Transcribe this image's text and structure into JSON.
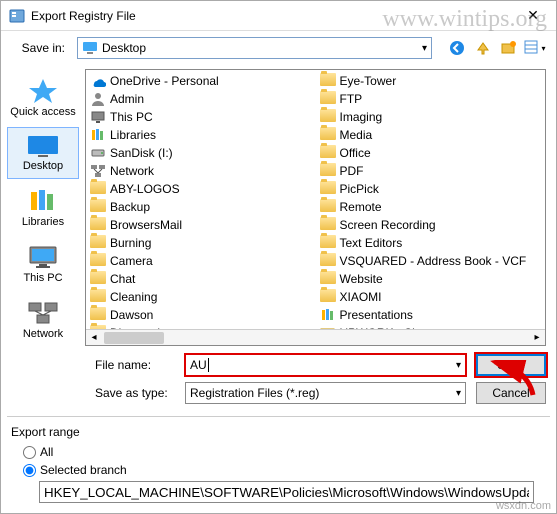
{
  "title": "Export Registry File",
  "watermark": "www.wintips.org",
  "watermark2": "wsxdn.com",
  "save_in_label": "Save in:",
  "save_in_value": "Desktop",
  "places": {
    "quick_access": "Quick access",
    "desktop": "Desktop",
    "libraries": "Libraries",
    "this_pc": "This PC",
    "network": "Network"
  },
  "col1": [
    {
      "label": "OneDrive - Personal",
      "icon": "onedrive"
    },
    {
      "label": "Admin",
      "icon": "user"
    },
    {
      "label": "This PC",
      "icon": "pc"
    },
    {
      "label": "Libraries",
      "icon": "libraries"
    },
    {
      "label": "SanDisk (I:)",
      "icon": "drive"
    },
    {
      "label": "Network",
      "icon": "network"
    },
    {
      "label": "ABY-LOGOS",
      "icon": "folder"
    },
    {
      "label": "Backup",
      "icon": "folder"
    },
    {
      "label": "BrowsersMail",
      "icon": "folder"
    },
    {
      "label": "Burning",
      "icon": "folder"
    },
    {
      "label": "Camera",
      "icon": "folder"
    },
    {
      "label": "Chat",
      "icon": "folder"
    },
    {
      "label": "Cleaning",
      "icon": "folder"
    },
    {
      "label": "Dawson",
      "icon": "folder"
    },
    {
      "label": "Diagnostics",
      "icon": "folder"
    }
  ],
  "col2": [
    {
      "label": "Eye-Tower",
      "icon": "folder"
    },
    {
      "label": "FTP",
      "icon": "folder"
    },
    {
      "label": "Imaging",
      "icon": "folder"
    },
    {
      "label": "Media",
      "icon": "folder"
    },
    {
      "label": "Office",
      "icon": "folder"
    },
    {
      "label": "PDF",
      "icon": "folder"
    },
    {
      "label": "PicPick",
      "icon": "folder"
    },
    {
      "label": "Remote",
      "icon": "folder"
    },
    {
      "label": "Screen Recording",
      "icon": "folder"
    },
    {
      "label": "Text Editors",
      "icon": "folder"
    },
    {
      "label": "VSQUARED - Address Book - VCF",
      "icon": "folder"
    },
    {
      "label": "Website",
      "icon": "folder"
    },
    {
      "label": "XIAOMI",
      "icon": "folder"
    },
    {
      "label": "Presentations",
      "icon": "libraries"
    },
    {
      "label": "UPWORK - Shortcut",
      "icon": "shortcut"
    }
  ],
  "file_name_label": "File name:",
  "file_name_value": "AU",
  "save_type_label": "Save as type:",
  "save_type_value": "Registration Files (*.reg)",
  "buttons": {
    "save": "Save",
    "cancel": "Cancel"
  },
  "export_range": {
    "title": "Export range",
    "all": "All",
    "selected": "Selected branch",
    "branch_value": "HKEY_LOCAL_MACHINE\\SOFTWARE\\Policies\\Microsoft\\Windows\\WindowsUpdate\\AU"
  }
}
